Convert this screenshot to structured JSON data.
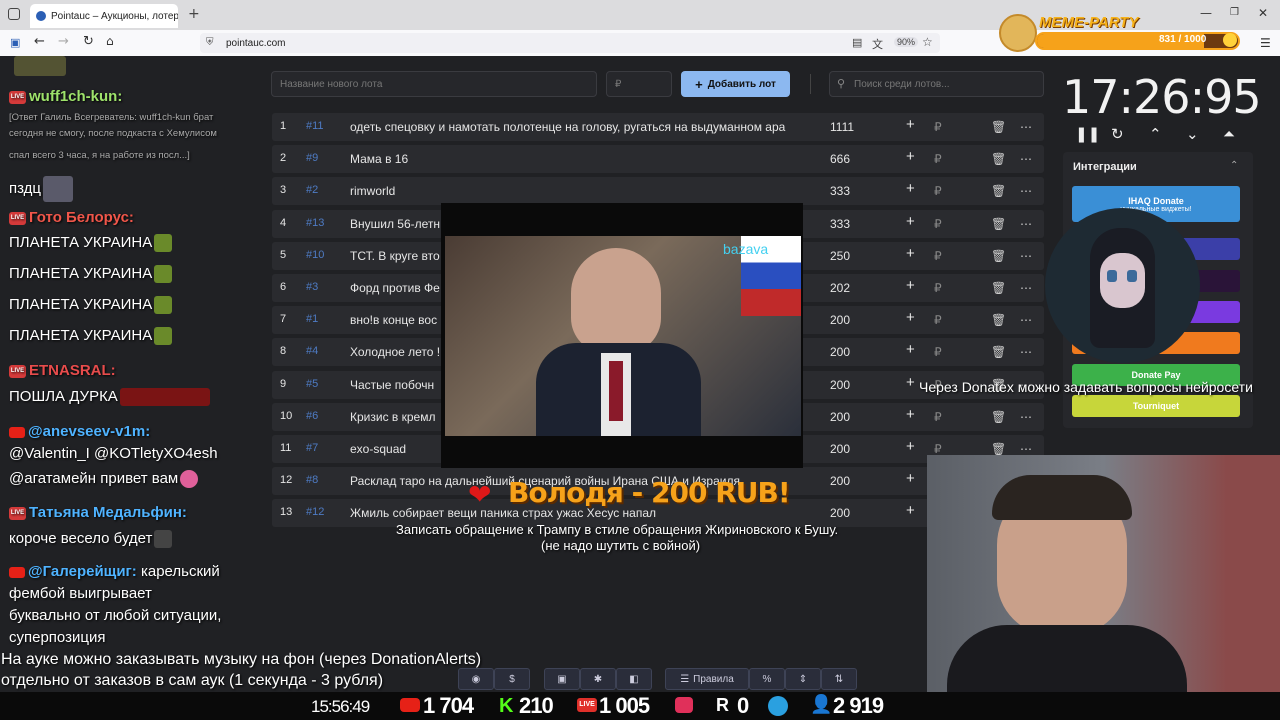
{
  "browser": {
    "tab_title": "Pointauc – Аукционы, лотереи",
    "url": "pointauc.com",
    "zoom": "90%",
    "new_tab": "+"
  },
  "auction": {
    "new_lot_placeholder": "Название нового лота",
    "amount_placeholder": "₽",
    "add_lot_label": "Добавить лот",
    "search_placeholder": "Поиск среди лотов...",
    "lots": [
      {
        "index": "1",
        "tag": "#11",
        "name": "одеть спецовку и намотать полотенце на голову, ругаться на выдуманном ара",
        "amount": "1111"
      },
      {
        "index": "2",
        "tag": "#9",
        "name": "Мама в 16",
        "amount": "666"
      },
      {
        "index": "3",
        "tag": "#2",
        "name": "rimworld",
        "amount": "333"
      },
      {
        "index": "4",
        "tag": "#13",
        "name": "Внушил 56-летн",
        "amount": "333"
      },
      {
        "index": "5",
        "tag": "#10",
        "name": "ТСТ. В круге вто",
        "amount": "250"
      },
      {
        "index": "6",
        "tag": "#3",
        "name": "Форд против Фе",
        "amount": "202"
      },
      {
        "index": "7",
        "tag": "#1",
        "name": "вно!в конце вос",
        "amount": "200"
      },
      {
        "index": "8",
        "tag": "#4",
        "name": "Холодное лето !",
        "amount": "200"
      },
      {
        "index": "9",
        "tag": "#5",
        "name": "Частые побочн",
        "amount": "200"
      },
      {
        "index": "10",
        "tag": "#6",
        "name": "Кризис в кремл",
        "amount": "200"
      },
      {
        "index": "11",
        "tag": "#7",
        "name": "exo-squad",
        "amount": "200"
      },
      {
        "index": "12",
        "tag": "#8",
        "name": "Расклад таро на дальнейший сценарий войны Ирана США и Израиля",
        "amount": "200"
      },
      {
        "index": "13",
        "tag": "#12",
        "name": "Жмиль собирает вещи паника страх ужас Хесус напал",
        "amount": "200"
      }
    ],
    "currency_symbol": "₽"
  },
  "timer": {
    "time": "17:26:95"
  },
  "integrations": {
    "title": "Интеграции",
    "buttons": [
      {
        "label": "IHAQ Donate",
        "sub": "уникальные виджеты!",
        "color": "#3a8fd6"
      },
      {
        "label": "er",
        "color": "#3b3fa8"
      },
      {
        "label": "",
        "color": "#2a1438"
      },
      {
        "label": "",
        "color": "#7a3ae0"
      },
      {
        "label": "Alerts",
        "color": "#f07a1e"
      },
      {
        "label": "Donate Pay",
        "color": "#3cb14a"
      },
      {
        "label": "Tourniquet",
        "color": "#c7d63a"
      }
    ]
  },
  "meme_party": {
    "title": "MEME-PARTY",
    "progress": "831 / 1000",
    "progress_fraction": 0.831
  },
  "donation": {
    "headline": "Володя - 200 RUB!",
    "message_line1": "Записать обращение к Трампу в стиле обращения Жириновского к Бушу.",
    "message_line2": "(не надо шутить с войной)",
    "video_watermark": "bazava"
  },
  "donatex_note": "Через Donatex можно задавать вопросы нейросети",
  "chat": {
    "messages": [
      {
        "nick": "wuff1ch-kun:",
        "nick_color": "#9ee26b",
        "text": ""
      },
      {
        "nick": "",
        "text": "[Ответ Галиль Всегреватель: wuff1ch-kun брат"
      },
      {
        "nick": "",
        "text": "сегодня не смогу, после подкаста с Хемулисом"
      },
      {
        "nick": "",
        "text": "спал всего 3 часа, я на работе из посл...]"
      },
      {
        "nick": "",
        "text": "пздц"
      },
      {
        "nick": "Гото Белорус:",
        "nick_color": "#f0564a",
        "text": ""
      },
      {
        "nick": "",
        "text": "ПЛАНЕТА УКРАИНА"
      },
      {
        "nick": "",
        "text": " ПЛАНЕТА УКРАИНА"
      },
      {
        "nick": "",
        "text": "ПЛАНЕТА УКРАИНА"
      },
      {
        "nick": "",
        "text": "ПЛАНЕТА УКРАИНА"
      },
      {
        "nick": "ETNASRAL:",
        "nick_color": "#e84c4c",
        "text": ""
      },
      {
        "nick": "",
        "text": "ПОШЛА ДУРКА"
      },
      {
        "nick": "@anevseev-v1m:",
        "nick_color": "#4fb3ff",
        "text": ""
      },
      {
        "nick": "",
        "text": "@Valentin_I @KOTletyXO4esh"
      },
      {
        "nick": "",
        "text": "@агатамейн привет вам"
      },
      {
        "nick": "Татьяна Медальфин:",
        "nick_color": "#4fb3ff",
        "text": ""
      },
      {
        "nick": "",
        "text": "короче весело будет"
      },
      {
        "nick": "@Галерейщиг:",
        "nick_color": "#4fb3ff",
        "text": "карельский"
      },
      {
        "nick": "",
        "text": "фембой выигрывает"
      },
      {
        "nick": "",
        "text": "буквально от любой ситуации,"
      },
      {
        "nick": "",
        "text": "суперпозиция"
      }
    ],
    "ticker_line1": "На ауке можно заказывать музыку на фон (через DonationAlerts)",
    "ticker_line2": "отдельно от заказов в сам аук (1 секунда - 3 рубля)"
  },
  "bottom_tools": {
    "rules_label": "Правила",
    "percent_label": "%"
  },
  "stats": {
    "clock": "15:56:49",
    "youtube": "1 704",
    "kick": "210",
    "vk_live": "1 005",
    "rutube": "",
    "r_count": "0",
    "total": "2 919"
  }
}
